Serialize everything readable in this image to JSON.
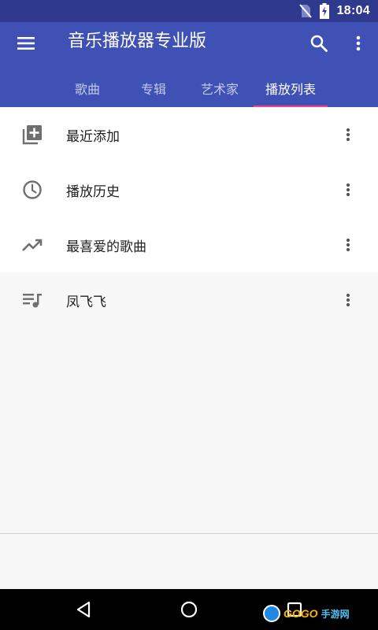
{
  "status_bar": {
    "time": "18:04",
    "icons": [
      "no-sim-icon",
      "battery-charging-icon"
    ]
  },
  "app_bar": {
    "title": "音乐播放器专业版",
    "icons": [
      "menu-icon",
      "search-icon",
      "more-vert-icon"
    ]
  },
  "tabs": [
    {
      "label": "歌曲",
      "active": false
    },
    {
      "label": "专辑",
      "active": false
    },
    {
      "label": "艺术家",
      "active": false
    },
    {
      "label": "播放列表",
      "active": true
    }
  ],
  "colors": {
    "primary": "#3f51b5",
    "primary_dark": "#2f3a8e",
    "accent": "#ff4081"
  },
  "auto_playlists": [
    {
      "label": "最近添加",
      "icon": "library-add-icon"
    },
    {
      "label": "播放历史",
      "icon": "clock-icon"
    },
    {
      "label": "最喜爱的歌曲",
      "icon": "trending-up-icon"
    }
  ],
  "user_playlists": [
    {
      "label": "凤飞飞",
      "icon": "queue-music-icon"
    }
  ],
  "nav_bar": {
    "icons": [
      "back-icon",
      "home-icon",
      "recents-icon"
    ]
  },
  "watermark": {
    "text": "GOGO",
    "text2": "手游网"
  }
}
